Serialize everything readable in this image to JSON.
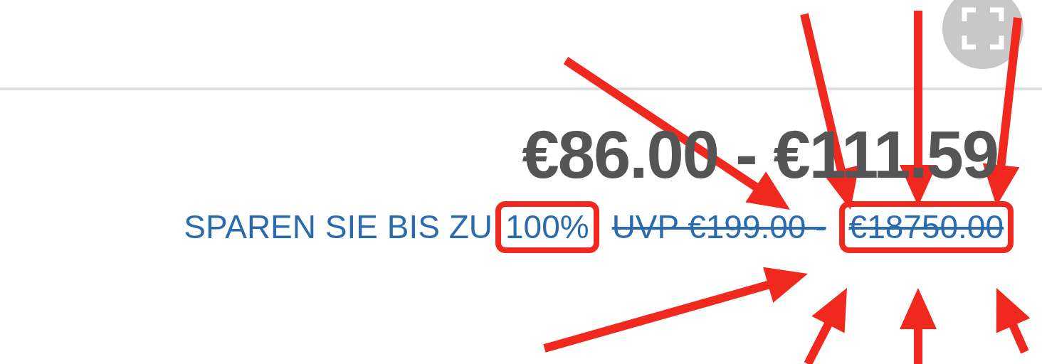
{
  "price_range": "€86.00 - €111.59",
  "savings": {
    "label": "SPAREN SIE BIS ZU",
    "percent": "100%",
    "highlighted": true
  },
  "list_price": [
    {
      "text": "UVP €199.00 -",
      "highlighted": false
    },
    {
      "text": "€18750.00",
      "highlighted": true
    }
  ]
}
